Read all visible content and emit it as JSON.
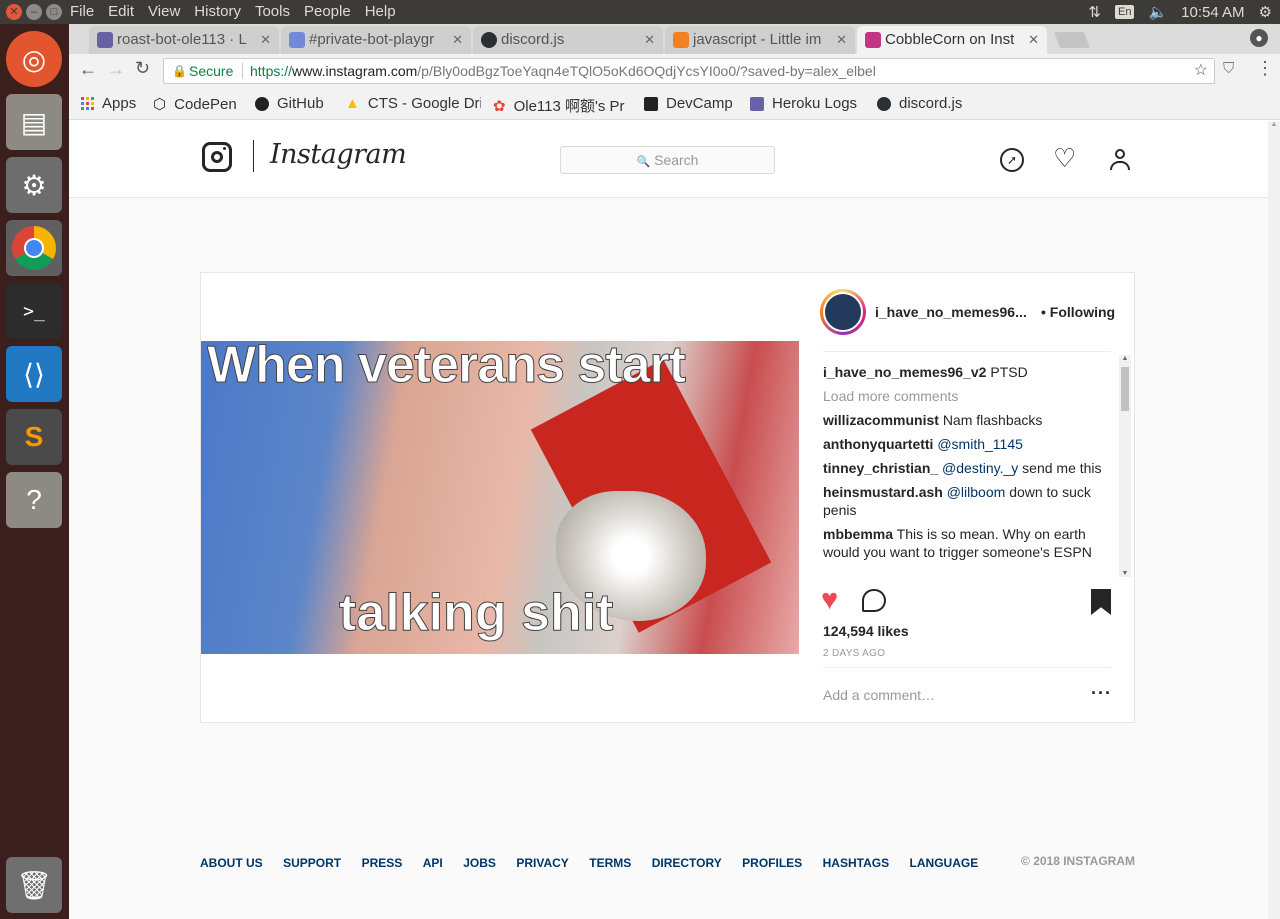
{
  "system": {
    "menu": [
      "File",
      "Edit",
      "View",
      "History",
      "Tools",
      "People",
      "Help"
    ],
    "keyboard": "En",
    "clock": "10:54 AM"
  },
  "tabs": [
    {
      "title": "roast-bot-ole113 · L",
      "icon_color": "#6762a6"
    },
    {
      "title": "#private-bot-playgr",
      "icon_color": "#7289da"
    },
    {
      "title": "discord.js",
      "icon_color": "#2c2f33"
    },
    {
      "title": "javascript - Little im",
      "icon_color": "#f48024"
    },
    {
      "title": "CobbleCorn on Inst",
      "icon_color": "#c13584"
    }
  ],
  "address": {
    "secure_label": "Secure",
    "scheme": "https://",
    "host": "www.instagram.com",
    "path": "/p/Bly0odBgzToeYaqn4eTQlO5oKd6OQdjYcsYI0o0/?saved-by=alex_elbel"
  },
  "bookmarks": [
    "Apps",
    "CodePen",
    "GitHub",
    "CTS - Google Dri",
    "Ole113 啊额's Pr",
    "DevCamp",
    "Heroku Logs",
    "discord.js"
  ],
  "instagram": {
    "wordmark": "Instagram",
    "search_placeholder": "Search",
    "post": {
      "caption_top": "When veterans start",
      "caption_bottom": "talking shit",
      "username": "i_have_no_memes96...",
      "follow_state": "• Following",
      "likes": "124,594 likes",
      "age": "2 DAYS AGO",
      "add_comment": "Add a comment…",
      "load_more": "Load more comments",
      "comments": [
        {
          "user": "i_have_no_memes96_v2",
          "mention": "",
          "text": "PTSD"
        },
        {
          "user": "willizacommunist",
          "mention": "",
          "text": "Nam flashbacks"
        },
        {
          "user": "anthonyquartetti",
          "mention": "@smith_1145",
          "text": ""
        },
        {
          "user": "tinney_christian_",
          "mention": "@destiny._y",
          "text": "send me this"
        },
        {
          "user": "heinsmustard.ash",
          "mention": "@lilboom",
          "text": "down to suck penis"
        },
        {
          "user": "mbbemma",
          "mention": "",
          "text": "This is so mean. Why on earth would you want to trigger someone's ESPN"
        }
      ]
    },
    "footer_links": [
      "ABOUT US",
      "SUPPORT",
      "PRESS",
      "API",
      "JOBS",
      "PRIVACY",
      "TERMS",
      "DIRECTORY",
      "PROFILES",
      "HASHTAGS",
      "LANGUAGE"
    ],
    "copyright": "© 2018 INSTAGRAM"
  }
}
